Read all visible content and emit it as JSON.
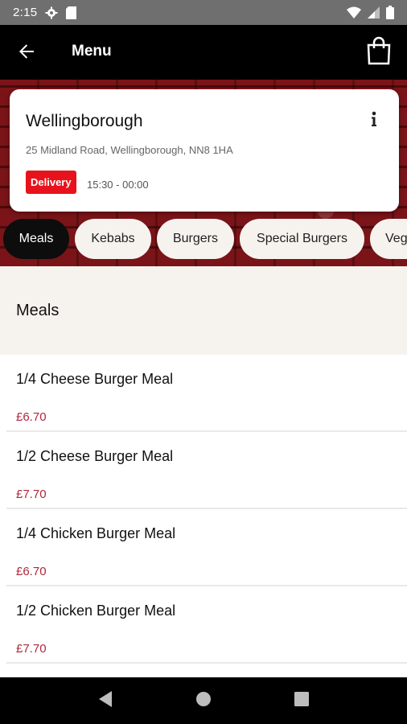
{
  "status_bar": {
    "time": "2:15",
    "icons": [
      "gear-icon",
      "sd-card-icon",
      "wifi-icon",
      "signal-icon",
      "battery-icon"
    ]
  },
  "app_bar": {
    "title": "Menu",
    "back_icon": "arrow-left-icon",
    "bag_icon": "shopping-bag-icon"
  },
  "store": {
    "name": "Wellingborough",
    "address": "25 Midland Road, Wellingborough, NN8 1HA",
    "badge": "Delivery",
    "hours": "15:30 - 00:00",
    "info_icon": "info-icon"
  },
  "tabs": [
    {
      "label": "Meals",
      "active": true
    },
    {
      "label": "Kebabs",
      "active": false
    },
    {
      "label": "Burgers",
      "active": false
    },
    {
      "label": "Special Burgers",
      "active": false
    },
    {
      "label": "Veg",
      "active": false
    }
  ],
  "section": {
    "title": "Meals"
  },
  "items": [
    {
      "name": "1/4 Cheese Burger Meal",
      "price": "£6.70"
    },
    {
      "name": "1/2 Cheese Burger Meal",
      "price": "£7.70"
    },
    {
      "name": "1/4 Chicken Burger Meal",
      "price": "£6.70"
    },
    {
      "name": "1/2 Chicken Burger Meal",
      "price": "£7.70"
    }
  ],
  "colors": {
    "accent_red": "#e8121d",
    "price_red": "#b0283a",
    "section_bg": "#f6f3ef"
  },
  "nav": {
    "back": "triangle-back-icon",
    "home": "circle-home-icon",
    "recents": "square-recents-icon"
  }
}
